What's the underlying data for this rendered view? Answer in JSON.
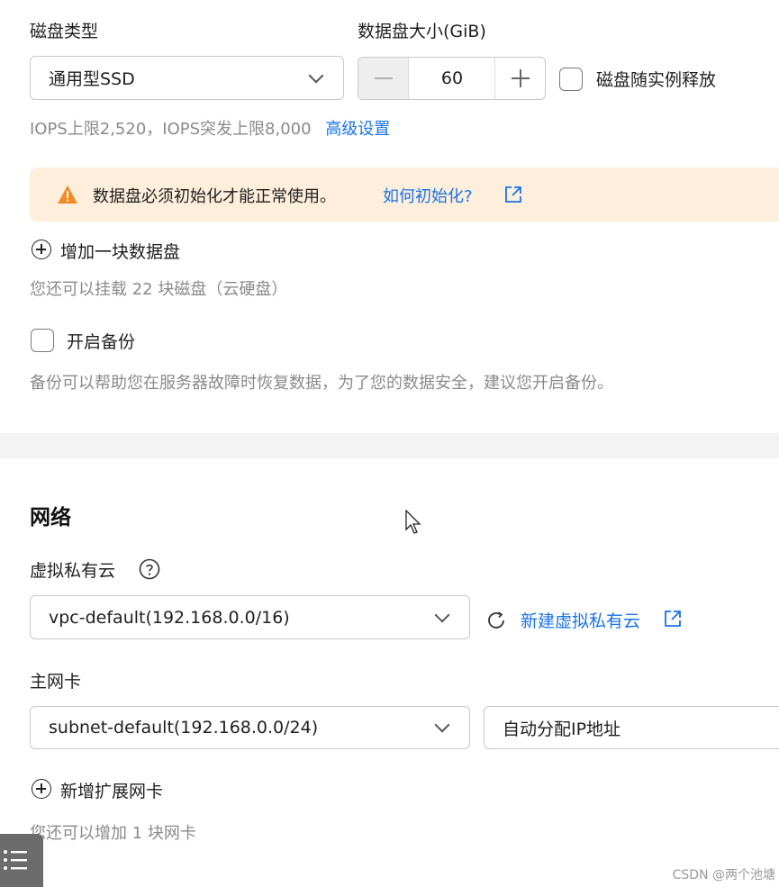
{
  "disk": {
    "type_label": "磁盘类型",
    "type_value": "通用型SSD",
    "size_label": "数据盘大小(GiB)",
    "size_value": "60",
    "release_label": "磁盘随实例释放",
    "iops_text": "IOPS上限2,520，IOPS突发上限8,000",
    "advanced_link": "高级设置"
  },
  "alert": {
    "message": "数据盘必须初始化才能正常使用。",
    "link": "如何初始化?",
    "color": "#fdefdc"
  },
  "add_disk": {
    "label": "增加一块数据盘",
    "hint": "您还可以挂载 22 块磁盘（云硬盘）"
  },
  "backup": {
    "label": "开启备份",
    "hint": "备份可以帮助您在服务器故障时恢复数据，为了您的数据安全，建议您开启备份。"
  },
  "network": {
    "title": "网络",
    "vpc_label": "虚拟私有云",
    "vpc_value": "vpc-default(192.168.0.0/16)",
    "new_vpc_link": "新建虚拟私有云",
    "nic_label": "主网卡",
    "subnet_value": "subnet-default(192.168.0.0/24)",
    "ip_value": "自动分配IP地址",
    "add_nic_label": "新增扩展网卡",
    "nic_hint": "您还可以增加 1 块网卡"
  },
  "watermark": "CSDN @两个池塘",
  "accent_color": "#1a73e8"
}
